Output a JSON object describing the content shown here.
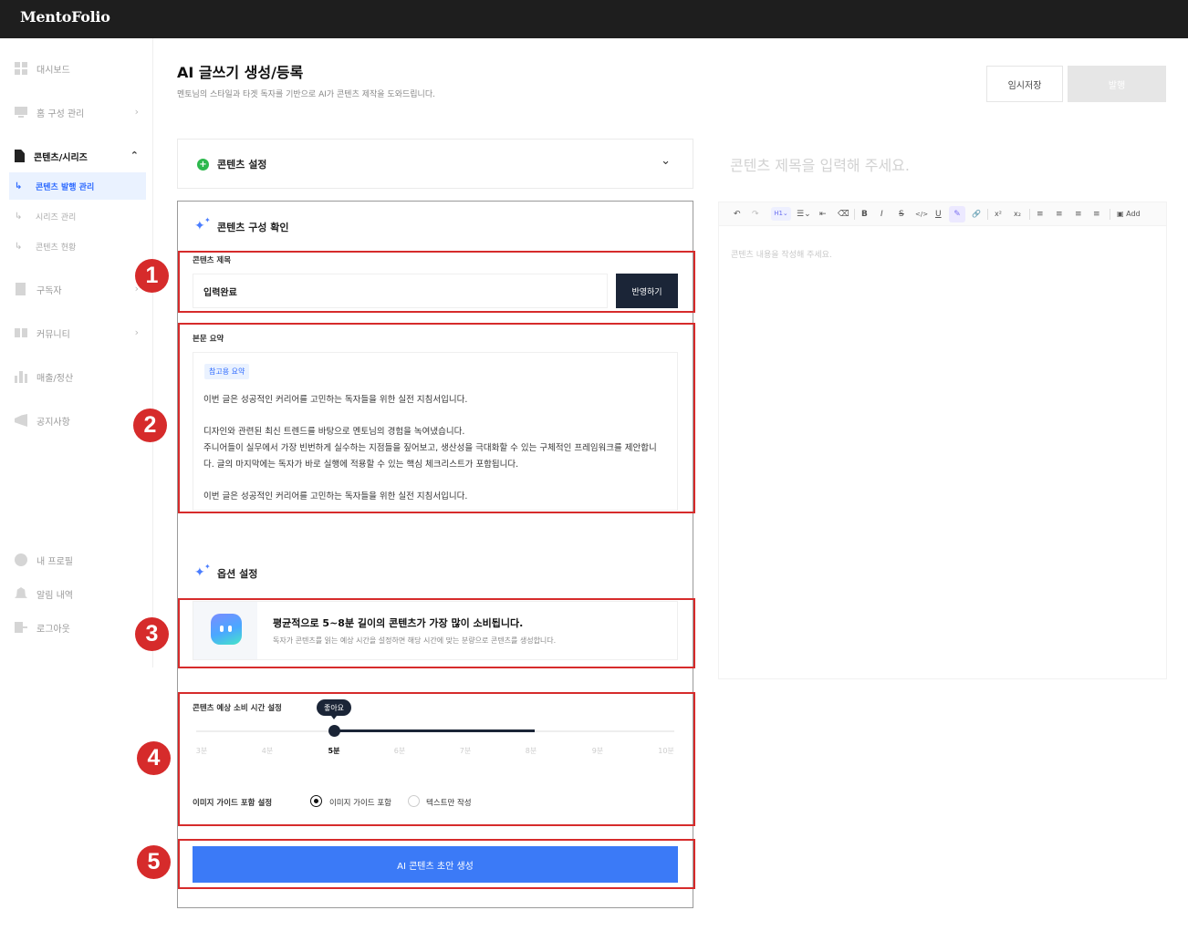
{
  "app": {
    "brand": "MentoFolio"
  },
  "sidebar": {
    "items": [
      {
        "label": "대시보드",
        "icon": "dashboard-icon"
      },
      {
        "label": "홈 구성 관리",
        "icon": "monitor-icon",
        "chevron": "›"
      },
      {
        "label": "콘텐츠/시리즈",
        "icon": "document-icon",
        "chevron": "⌃"
      },
      {
        "label": "구독자",
        "icon": "subscriber-icon",
        "chevron": "›"
      },
      {
        "label": "커뮤니티",
        "icon": "community-icon",
        "chevron": "›"
      },
      {
        "label": "매출/정산",
        "icon": "sales-icon"
      },
      {
        "label": "공지사항",
        "icon": "megaphone-icon"
      },
      {
        "label": "내 프로필",
        "icon": "profile-icon"
      },
      {
        "label": "알림 내역",
        "icon": "bell-icon"
      },
      {
        "label": "로그아웃",
        "icon": "logout-icon"
      }
    ],
    "sub_items": [
      {
        "label": "콘텐츠 발행 관리",
        "arrow": "↳"
      },
      {
        "label": "시리즈 관리",
        "arrow": "↳"
      },
      {
        "label": "콘텐츠 현황",
        "arrow": "↳"
      }
    ]
  },
  "header": {
    "title": "AI 글쓰기 생성/등록",
    "subtitle": "멘토님의 스타일과 타겟 독자를 기반으로 AI가 콘텐츠 제작을 도와드립니다.",
    "draft_label": "임시저장",
    "publish_label": "발행"
  },
  "settings": {
    "icon_glyph": "+",
    "label": "콘텐츠 설정",
    "chevron": "⌄"
  },
  "composition": {
    "title": "콘텐츠 구성 확인",
    "sparkle": "✦",
    "title_field": {
      "label": "콘텐츠 제목",
      "value": "입력완료",
      "apply_label": "반영하기"
    },
    "summary": {
      "label": "본문 요약",
      "badge": "참고용 요약",
      "lines": [
        "이번 글은 성공적인 커리어를 고민하는 독자들을 위한 실전 지침서입니다.",
        "디자인와 관련된 최신 트렌드를 바탕으로 멘토님의 경험을 녹여냈습니다.",
        "주니어들이 실무에서 가장 빈번하게 실수하는 지점들을 짚어보고, 생산성을 극대화할 수 있는 구체적인 프레임워크를 제안합니",
        "다. 글의 마지막에는 독자가 바로 실행에 적용할 수 있는 핵심 체크리스트가 포함됩니다.",
        "이번 글은 성공적인 커리어를 고민하는 독자들을 위한 실전 지침서입니다."
      ]
    }
  },
  "options": {
    "title": "옵션 설정",
    "info_title": "평균적으로 5~8분 길이의 콘텐츠가 가장 많이 소비됩니다.",
    "info_desc": "독자가 콘텐츠를 읽는 예상 시간을 설정하면 해당 시간에 맞는 분량으로 콘텐츠를 생성합니다.",
    "time": {
      "label": "콘텐츠 예상 소비 시간 설정",
      "tooltip": "좋아요",
      "ticks": [
        "3분",
        "4분",
        "5분",
        "6분",
        "7분",
        "8분",
        "9분",
        "10분"
      ],
      "selected": "5분",
      "range_end": "8분"
    },
    "image_guide": {
      "label": "이미지 가이드 포함 설정",
      "options": [
        "이미지 가이드 포함",
        "텍스트만 작성"
      ],
      "selected": "이미지 가이드 포함"
    },
    "generate_label": "AI 콘텐츠 초안 생성"
  },
  "annotations": [
    "1",
    "2",
    "3",
    "4",
    "5"
  ],
  "editor": {
    "title_placeholder": "콘텐츠 제목을 입력해 주세요.",
    "body_placeholder": "콘텐츠 내용을 작성해 주세요.",
    "toolbar": {
      "undo": "↶",
      "redo": "↷",
      "heading": "H1⌄",
      "list": "☰⌄",
      "indent": "⇤",
      "clear": "⌫",
      "bold": "B",
      "italic": "I",
      "strike": "S",
      "code": "</>",
      "underline": "U",
      "highlight": "✎",
      "link": "🔗",
      "superscript": "x²",
      "subscript": "x₂",
      "align_left": "≡",
      "align_center": "≡",
      "align_right": "≡",
      "align_justify": "≡",
      "add_label": "Add"
    }
  },
  "colors": {
    "accent": "#3b7af7",
    "dark": "#1b2537",
    "annotation": "#d62b2b",
    "success": "#2db84d"
  }
}
